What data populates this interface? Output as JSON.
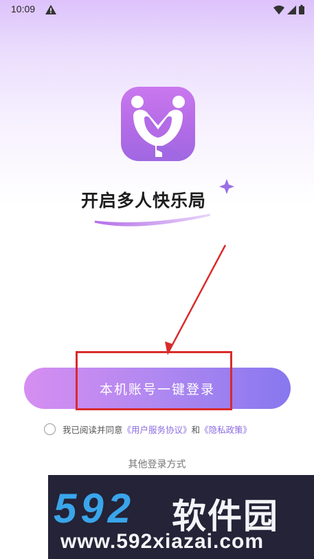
{
  "status_bar": {
    "time": "10:09",
    "icons": [
      "warning-icon",
      "wifi-icon",
      "signal-icon",
      "battery-icon"
    ]
  },
  "brand": {
    "logo_icon": "app-logo-icon",
    "slogan": "开启多人快乐局",
    "accent": "#b36be6"
  },
  "login": {
    "one_click_label": "本机账号一键登录",
    "gradient_start": "#d68ef1",
    "gradient_end": "#8877ef"
  },
  "agreement": {
    "prefix": "我已阅读并同意",
    "user_agreement": "《用户服务协议》",
    "conjunction": "和",
    "privacy_policy": "《隐私政策》",
    "checked": false
  },
  "other_login": {
    "label": "其他登录方式"
  },
  "annotation": {
    "color": "#d92b2b"
  },
  "watermark": {
    "number": "592",
    "name": "软件园",
    "url": "www.592xiazai.com"
  }
}
